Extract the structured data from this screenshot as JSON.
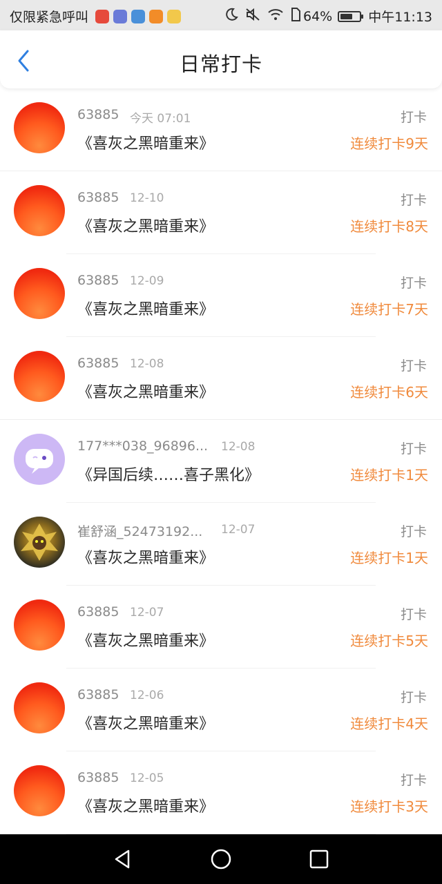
{
  "status_bar": {
    "left_text": "仅限紧急呼叫",
    "battery_pct": "64%",
    "battery_level": 0.64,
    "time": "中午11:13",
    "app_icon_colors": [
      "#e64a3c",
      "#6a7bd8",
      "#4a90d9",
      "#f28c28",
      "#f2c84b"
    ]
  },
  "header": {
    "title": "日常打卡"
  },
  "colors": {
    "accent": "#f08a3c",
    "back_arrow": "#2f7fe0"
  },
  "records": [
    {
      "user": "63885",
      "date": "今天 07:01",
      "book": "《喜灰之黑暗重来》",
      "action": "打卡",
      "streak": "连续打卡9天",
      "avatar": "orange"
    },
    {
      "user": "63885",
      "date": "12-10",
      "book": "《喜灰之黑暗重来》",
      "action": "打卡",
      "streak": "连续打卡8天",
      "avatar": "orange"
    },
    {
      "user": "63885",
      "date": "12-09",
      "book": "《喜灰之黑暗重来》",
      "action": "打卡",
      "streak": "连续打卡7天",
      "avatar": "orange"
    },
    {
      "user": "63885",
      "date": "12-08",
      "book": "《喜灰之黑暗重来》",
      "action": "打卡",
      "streak": "连续打卡6天",
      "avatar": "orange"
    },
    {
      "user": "177***038_96896...",
      "date": "12-08",
      "book": "《异国后续……喜子黑化》",
      "action": "打卡",
      "streak": "连续打卡1天",
      "avatar": "purple"
    },
    {
      "user": "崔舒涵_52473192...",
      "date": "12-07",
      "book": "《喜灰之黑暗重来》",
      "action": "打卡",
      "streak": "连续打卡1天",
      "avatar": "dark"
    },
    {
      "user": "63885",
      "date": "12-07",
      "book": "《喜灰之黑暗重来》",
      "action": "打卡",
      "streak": "连续打卡5天",
      "avatar": "orange"
    },
    {
      "user": "63885",
      "date": "12-06",
      "book": "《喜灰之黑暗重来》",
      "action": "打卡",
      "streak": "连续打卡4天",
      "avatar": "orange"
    },
    {
      "user": "63885",
      "date": "12-05",
      "book": "《喜灰之黑暗重来》",
      "action": "打卡",
      "streak": "连续打卡3天",
      "avatar": "orange"
    }
  ]
}
